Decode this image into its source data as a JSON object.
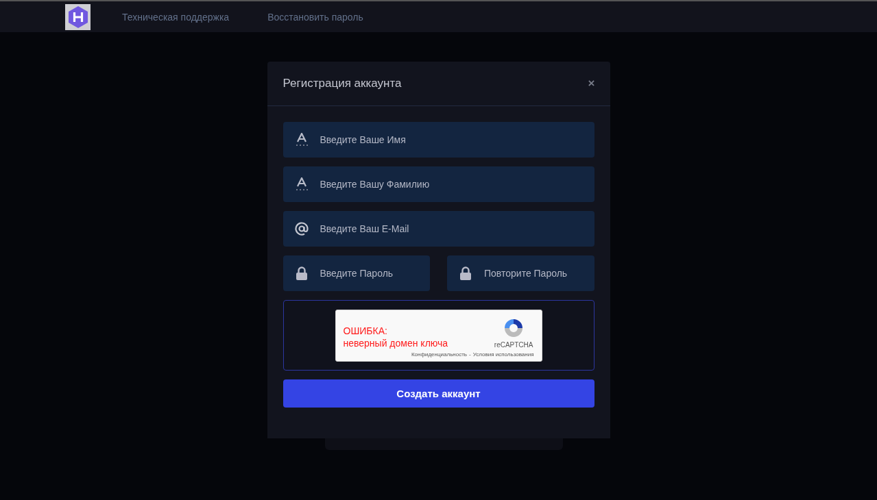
{
  "nav": {
    "links": [
      "Техническая поддержка",
      "Восстановить пароль"
    ]
  },
  "modal": {
    "title": "Регистрация аккаунта",
    "close": "×",
    "fields": [
      {
        "kind": "name",
        "placeholder": "Введите Ваше Имя"
      },
      {
        "kind": "name",
        "placeholder": "Введите Вашу Фамилию"
      },
      {
        "kind": "email",
        "placeholder": "Введите Ваш E-Mail"
      }
    ],
    "password_fields": [
      {
        "kind": "password",
        "placeholder": "Введите Пароль"
      },
      {
        "kind": "password",
        "placeholder": "Повторите Пароль"
      }
    ],
    "captcha": {
      "error_title": "ОШИБКА:",
      "error_text": "неверный домен ключа",
      "brand": "reCAPTCHA",
      "privacy": "Конфиденциальность",
      "separator": "-",
      "terms": "Условия использования"
    },
    "submit": "Создать аккаунт"
  }
}
